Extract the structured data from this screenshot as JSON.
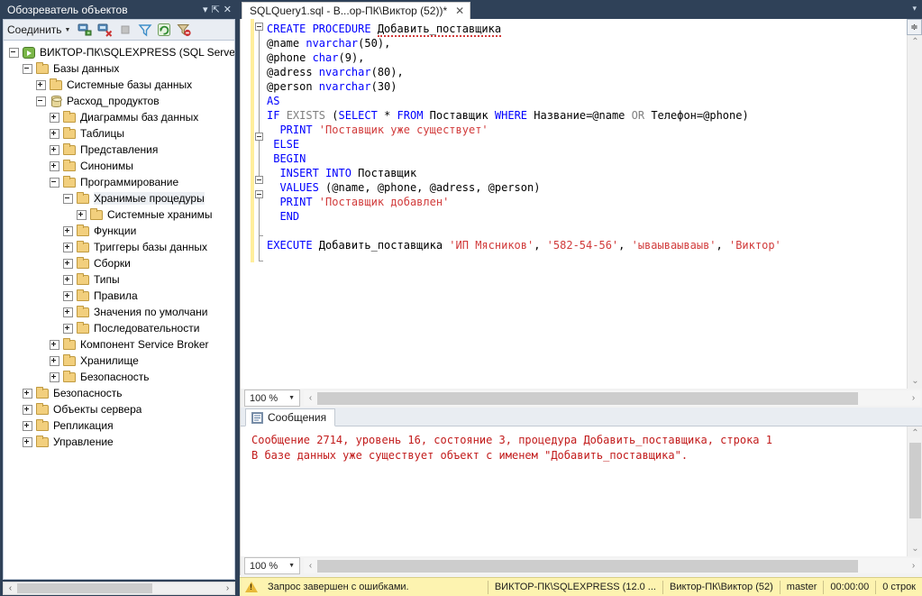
{
  "object_explorer": {
    "title": "Обозреватель объектов",
    "title_buttons": [
      {
        "name": "dropdown-icon",
        "glyph": "▾"
      },
      {
        "name": "pin-icon",
        "glyph": "⇱"
      },
      {
        "name": "close-icon",
        "glyph": "✕"
      }
    ],
    "toolbar": {
      "connect_label": "Соединить",
      "connect_caret": "▼",
      "icons": [
        "connect-object-explorer-icon",
        "disconnect-object-explorer-icon",
        "stop-icon",
        "filter-icon",
        "refresh-icon",
        "remove-filter-icon"
      ]
    },
    "tree": [
      {
        "label": "ВИКТОР-ПК\\SQLEXPRESS (SQL Server ",
        "indent": 0,
        "expander": "minus",
        "icon": "server-icon",
        "selected": false
      },
      {
        "label": "Базы данных",
        "indent": 1,
        "expander": "minus",
        "icon": "folder-icon",
        "selected": false
      },
      {
        "label": "Системные базы данных",
        "indent": 2,
        "expander": "plus",
        "icon": "folder-icon",
        "selected": false
      },
      {
        "label": "Расход_продуктов",
        "indent": 2,
        "expander": "minus",
        "icon": "database-icon",
        "selected": false
      },
      {
        "label": "Диаграммы баз данных",
        "indent": 3,
        "expander": "plus",
        "icon": "folder-icon",
        "selected": false
      },
      {
        "label": "Таблицы",
        "indent": 3,
        "expander": "plus",
        "icon": "folder-icon",
        "selected": false
      },
      {
        "label": "Представления",
        "indent": 3,
        "expander": "plus",
        "icon": "folder-icon",
        "selected": false
      },
      {
        "label": "Синонимы",
        "indent": 3,
        "expander": "plus",
        "icon": "folder-icon",
        "selected": false
      },
      {
        "label": "Программирование",
        "indent": 3,
        "expander": "minus",
        "icon": "folder-icon",
        "selected": false
      },
      {
        "label": "Хранимые процедуры",
        "indent": 4,
        "expander": "minus",
        "icon": "folder-icon",
        "selected": true
      },
      {
        "label": "Системные хранимы",
        "indent": 5,
        "expander": "plus",
        "icon": "folder-icon",
        "selected": false
      },
      {
        "label": "Функции",
        "indent": 4,
        "expander": "plus",
        "icon": "folder-icon",
        "selected": false
      },
      {
        "label": "Триггеры базы данных",
        "indent": 4,
        "expander": "plus",
        "icon": "folder-icon",
        "selected": false
      },
      {
        "label": "Сборки",
        "indent": 4,
        "expander": "plus",
        "icon": "folder-icon",
        "selected": false
      },
      {
        "label": "Типы",
        "indent": 4,
        "expander": "plus",
        "icon": "folder-icon",
        "selected": false
      },
      {
        "label": "Правила",
        "indent": 4,
        "expander": "plus",
        "icon": "folder-icon",
        "selected": false
      },
      {
        "label": "Значения по умолчани",
        "indent": 4,
        "expander": "plus",
        "icon": "folder-icon",
        "selected": false
      },
      {
        "label": "Последовательности",
        "indent": 4,
        "expander": "plus",
        "icon": "folder-icon",
        "selected": false
      },
      {
        "label": "Компонент Service Broker",
        "indent": 3,
        "expander": "plus",
        "icon": "folder-icon",
        "selected": false
      },
      {
        "label": "Хранилище",
        "indent": 3,
        "expander": "plus",
        "icon": "folder-icon",
        "selected": false
      },
      {
        "label": "Безопасность",
        "indent": 3,
        "expander": "plus",
        "icon": "folder-icon",
        "selected": false
      },
      {
        "label": "Безопасность",
        "indent": 1,
        "expander": "plus",
        "icon": "folder-icon",
        "selected": false
      },
      {
        "label": "Объекты сервера",
        "indent": 1,
        "expander": "plus",
        "icon": "folder-icon",
        "selected": false
      },
      {
        "label": "Репликация",
        "indent": 1,
        "expander": "plus",
        "icon": "folder-icon",
        "selected": false
      },
      {
        "label": "Управление",
        "indent": 1,
        "expander": "plus",
        "icon": "folder-icon",
        "selected": false
      }
    ]
  },
  "editor": {
    "tab_title": "SQLQuery1.sql - В...ор-ПК\\Виктор (52))*",
    "tab_close_glyph": "✕",
    "tabstrip_menu_glyph": "▾",
    "split_button_glyph": "≑",
    "zoom_level": "100 %",
    "zoom_caret": "▼",
    "code_lines": [
      [
        {
          "t": "CREATE PROCEDURE ",
          "c": "kw"
        },
        {
          "t": "Добавить_поставщика",
          "c": "squig"
        }
      ],
      [
        {
          "t": "@name ",
          "c": ""
        },
        {
          "t": "nvarchar",
          "c": "kw"
        },
        {
          "t": "(",
          "c": ""
        },
        {
          "t": "50",
          "c": "num"
        },
        {
          "t": "),",
          "c": ""
        }
      ],
      [
        {
          "t": "@phone ",
          "c": ""
        },
        {
          "t": "char",
          "c": "kw"
        },
        {
          "t": "(",
          "c": ""
        },
        {
          "t": "9",
          "c": "num"
        },
        {
          "t": "),",
          "c": ""
        }
      ],
      [
        {
          "t": "@adress ",
          "c": ""
        },
        {
          "t": "nvarchar",
          "c": "kw"
        },
        {
          "t": "(",
          "c": ""
        },
        {
          "t": "80",
          "c": "num"
        },
        {
          "t": "),",
          "c": ""
        }
      ],
      [
        {
          "t": "@person ",
          "c": ""
        },
        {
          "t": "nvarchar",
          "c": "kw"
        },
        {
          "t": "(",
          "c": ""
        },
        {
          "t": "30",
          "c": "num"
        },
        {
          "t": ")",
          "c": ""
        }
      ],
      [
        {
          "t": "AS",
          "c": "kw"
        }
      ],
      [
        {
          "t": "IF ",
          "c": "kw"
        },
        {
          "t": "EXISTS ",
          "c": "kwg"
        },
        {
          "t": "(",
          "c": ""
        },
        {
          "t": "SELECT ",
          "c": "kw"
        },
        {
          "t": "* ",
          "c": ""
        },
        {
          "t": "FROM ",
          "c": "kw"
        },
        {
          "t": "Поставщик ",
          "c": ""
        },
        {
          "t": "WHERE ",
          "c": "kw"
        },
        {
          "t": "Название=@name ",
          "c": ""
        },
        {
          "t": "OR ",
          "c": "kwg"
        },
        {
          "t": "Телефон=@phone)",
          "c": ""
        }
      ],
      [
        {
          "t": "  PRINT ",
          "c": "kw"
        },
        {
          "t": "'Поставщик уже существует'",
          "c": "str"
        }
      ],
      [
        {
          "t": " ELSE",
          "c": "kw"
        }
      ],
      [
        {
          "t": " BEGIN",
          "c": "kw"
        }
      ],
      [
        {
          "t": "  INSERT INTO ",
          "c": "kw"
        },
        {
          "t": "Поставщик",
          "c": ""
        }
      ],
      [
        {
          "t": "  VALUES ",
          "c": "kw"
        },
        {
          "t": "(@name, @phone, @adress, @person)",
          "c": ""
        }
      ],
      [
        {
          "t": "  PRINT ",
          "c": "kw"
        },
        {
          "t": "'Поставщик добавлен'",
          "c": "str"
        }
      ],
      [
        {
          "t": "  END",
          "c": "kw"
        }
      ],
      [],
      [
        {
          "t": "EXECUTE ",
          "c": "kw"
        },
        {
          "t": "Добавить_поставщика ",
          "c": ""
        },
        {
          "t": "'ИП Мясников'",
          "c": "str"
        },
        {
          "t": ", ",
          "c": ""
        },
        {
          "t": "'582-54-56'",
          "c": "str"
        },
        {
          "t": ", ",
          "c": ""
        },
        {
          "t": "'ываываываыв'",
          "c": "str"
        },
        {
          "t": ", ",
          "c": ""
        },
        {
          "t": "'Виктор'",
          "c": "str"
        }
      ]
    ]
  },
  "messages": {
    "tab_label": "Сообщения",
    "tab_icon": "messages-icon",
    "zoom_level": "100 %",
    "zoom_caret": "▼",
    "lines": [
      "Сообщение 2714, уровень 16, состояние 3, процедура Добавить_поставщика, строка 1",
      "В базе данных уже существует объект с именем \"Добавить_поставщика\"."
    ]
  },
  "status_bar": {
    "warning_icon": "warning-icon",
    "message": "Запрос завершен с ошибками.",
    "server": "ВИКТОР-ПК\\SQLEXPRESS (12.0 ...",
    "user": "Виктор-ПК\\Виктор (52)",
    "database": "master",
    "elapsed": "00:00:00",
    "rows": "0 строк"
  },
  "scroll": {
    "up_glyph": "⌃",
    "down_glyph": "⌄",
    "left_glyph": "‹",
    "right_glyph": "›"
  },
  "colors": {
    "chrome": "#2f4158",
    "keyword": "#0000ff",
    "string": "#d13b3b",
    "error_text": "#c21b1b",
    "status_bg": "#fdf3b0",
    "changebar": "#ffee9c"
  }
}
